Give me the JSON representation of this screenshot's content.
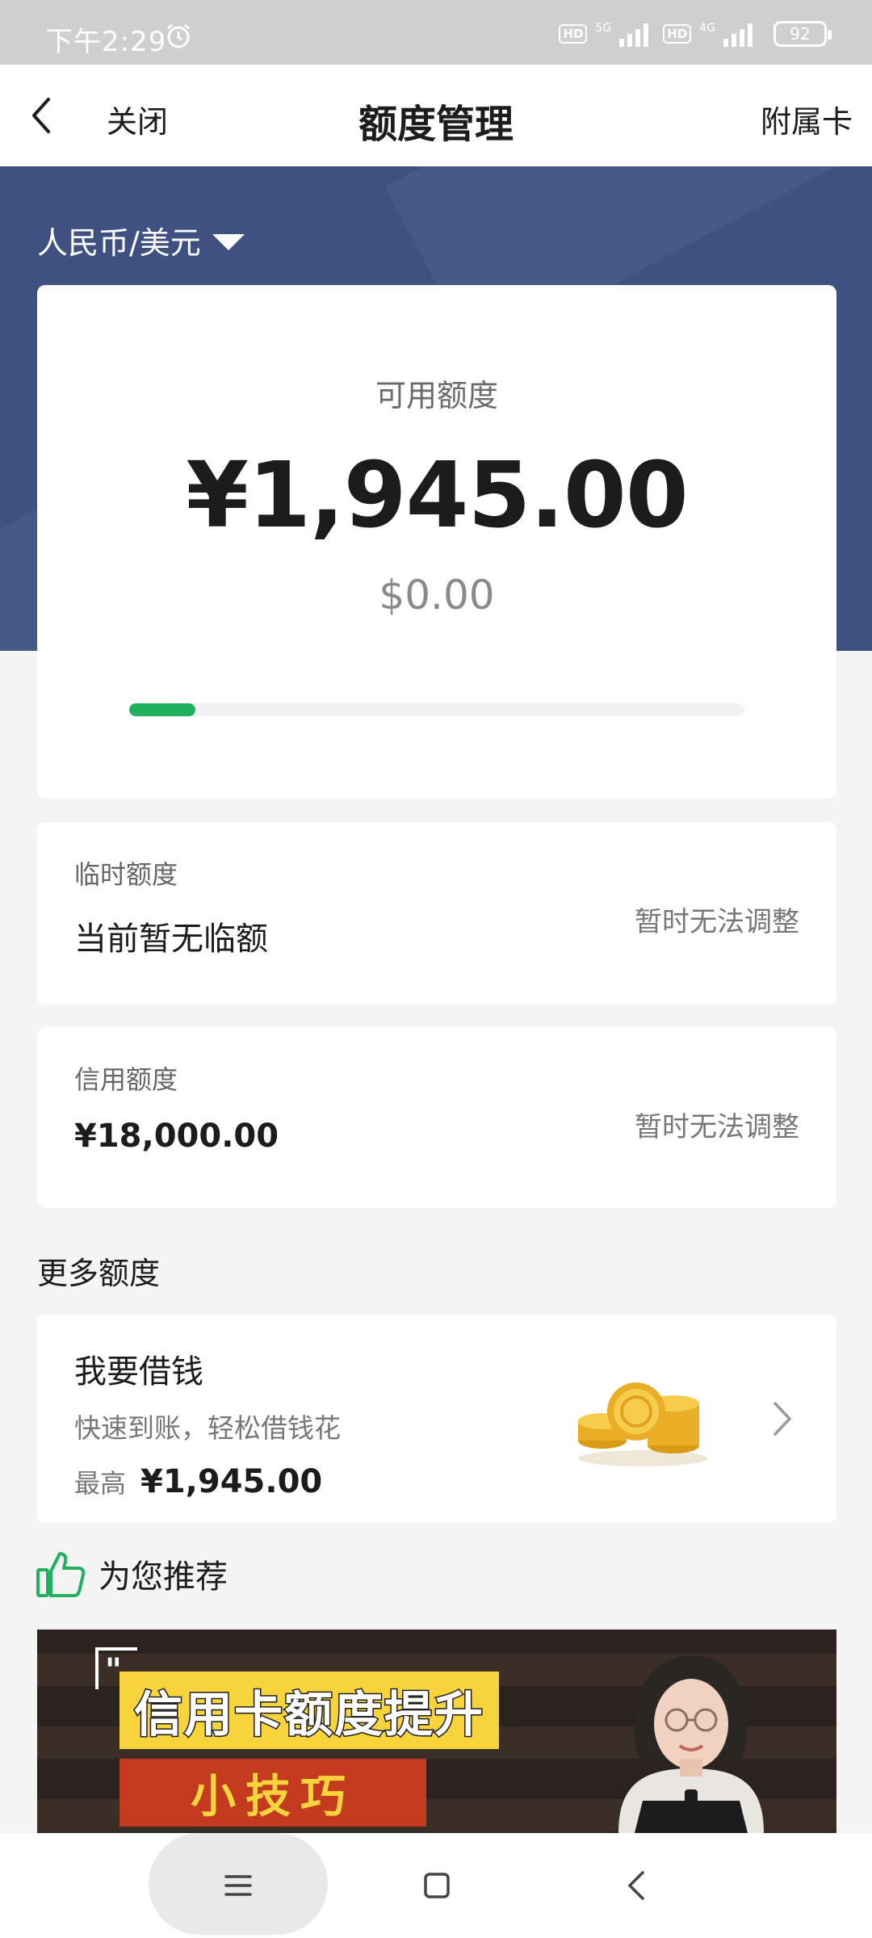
{
  "status_bar": {
    "time": "下午2:29",
    "hd_label": "HD",
    "network_1": "5G",
    "network_2": "4G",
    "battery": "92"
  },
  "nav": {
    "close_label": "关闭",
    "title": "额度管理",
    "right_label": "附属卡"
  },
  "currency_selector": {
    "label": "人民币/美元"
  },
  "available": {
    "label": "可用额度",
    "amount": "¥1,945.00",
    "usd_amount": "$0.00",
    "usage_fraction": 0.108
  },
  "temporary_limit": {
    "label": "临时额度",
    "value": "当前暂无临额",
    "action": "暂时无法调整"
  },
  "credit_limit": {
    "label": "信用额度",
    "value": "¥18,000.00",
    "action": "暂时无法调整"
  },
  "more_limits": {
    "title": "更多额度",
    "loan": {
      "title": "我要借钱",
      "subtitle": "快速到账，轻松借钱花",
      "max_label": "最高",
      "max_amount": "¥1,945.00"
    }
  },
  "recommend": {
    "title": "为您推荐",
    "banner_title": "信用卡额度提升",
    "banner_subtitle": "小技巧"
  },
  "colors": {
    "header_bg": "#3e5180",
    "progress": "#21b05e",
    "thumb": "#21b05e",
    "banner_yellow": "#f7d33c"
  },
  "icons": [
    "back-icon",
    "alarm-icon",
    "caret-down-icon",
    "coins-icon",
    "chevron-right-icon",
    "thumbs-up-icon",
    "menu-icon",
    "home-icon",
    "nav-back-icon"
  ]
}
